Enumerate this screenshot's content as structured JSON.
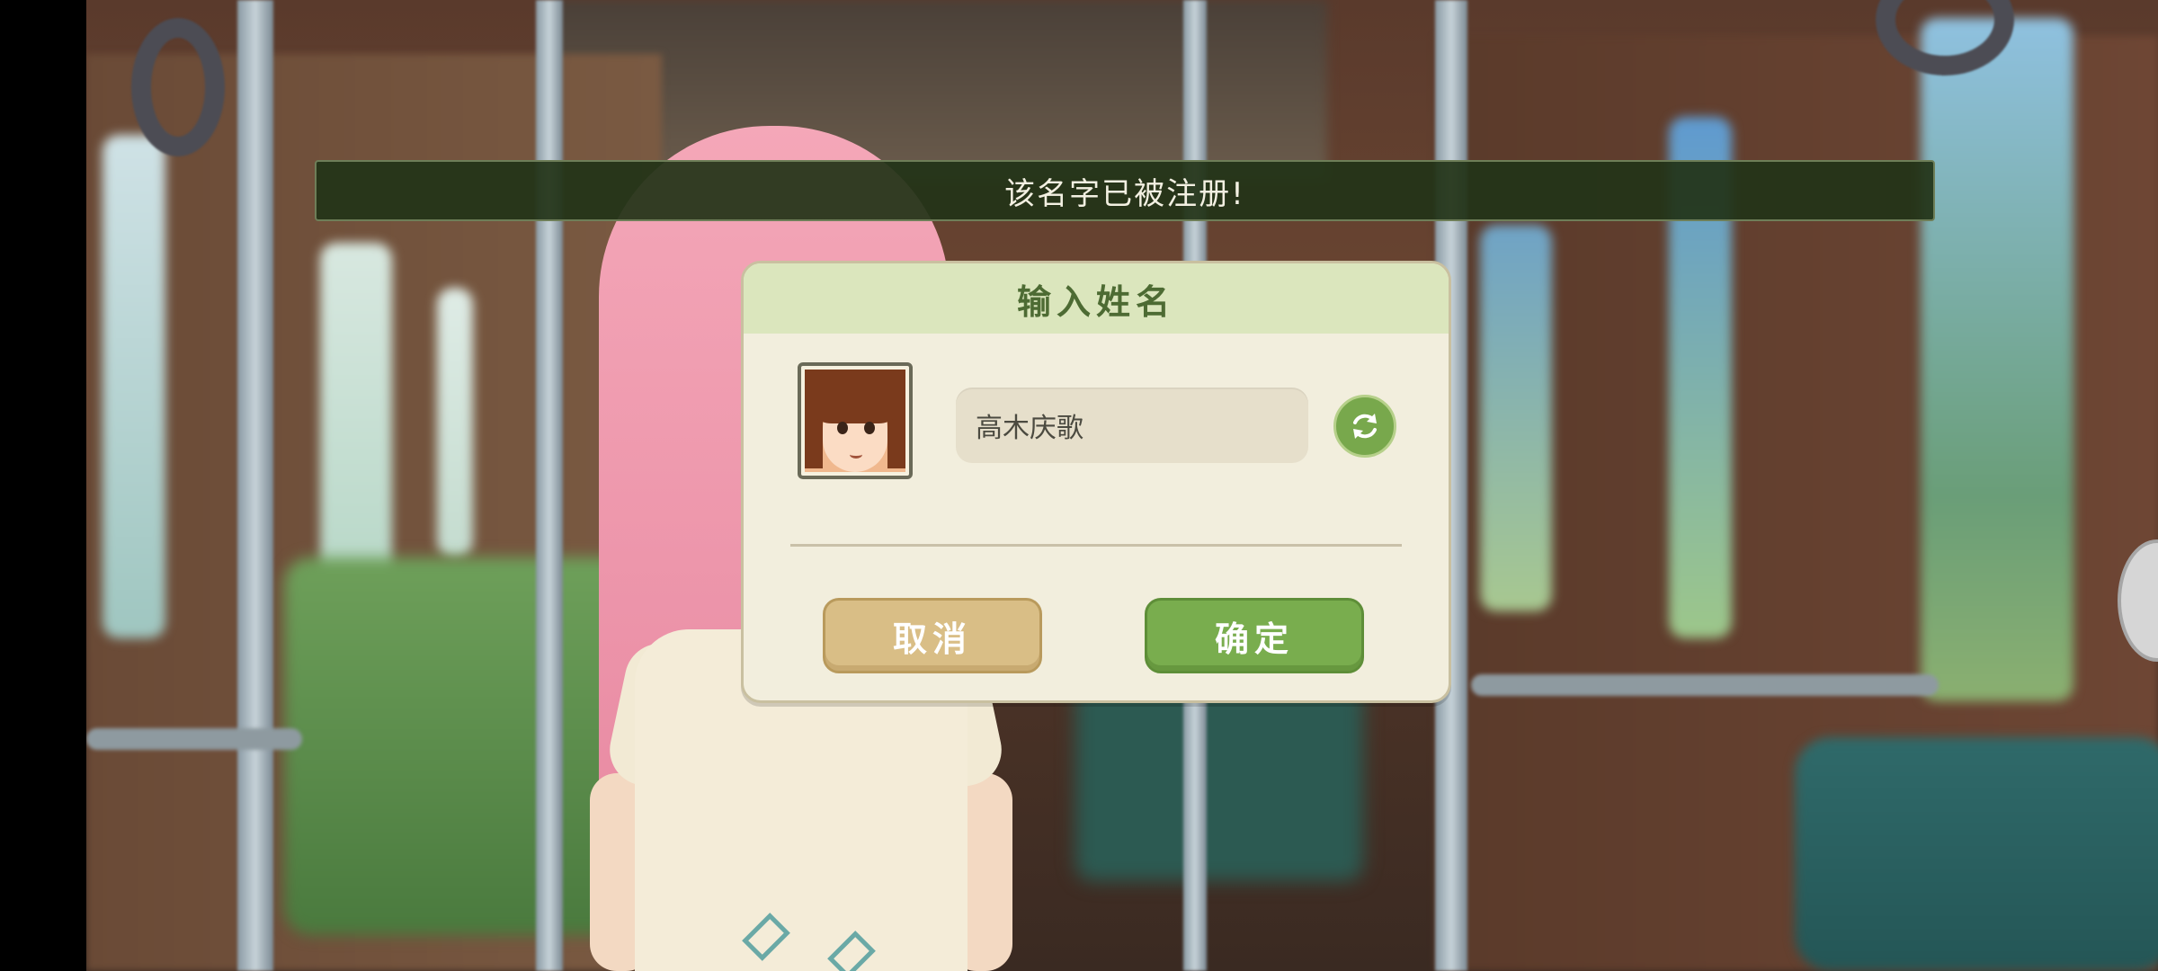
{
  "toast": {
    "message": "该名字已被注册!"
  },
  "dialog": {
    "title": "输入姓名",
    "name_input": {
      "value": "高木庆歌"
    },
    "cancel_label": "取消",
    "confirm_label": "确定"
  },
  "colors": {
    "header_bg": "#dbe6bd",
    "title_text": "#4d6b33",
    "confirm_button": "#79ad4e",
    "cancel_button": "#d9be86",
    "toast_bg": "#223418"
  },
  "icons": {
    "refresh": "refresh-icon",
    "avatar": "character-avatar"
  }
}
